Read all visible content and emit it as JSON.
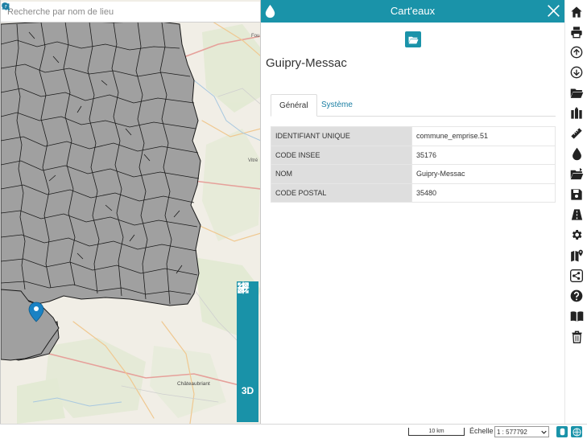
{
  "search": {
    "placeholder": "Recherche par nom de lieu",
    "value": ""
  },
  "map": {
    "place_labels": [
      {
        "id": "fou",
        "text": "Fou"
      },
      {
        "id": "vitr",
        "text": "Vitré"
      },
      {
        "id": "chateaubriant",
        "text": "Châteaubriant"
      }
    ],
    "controls": {
      "locate_icon": "crosshair-icon",
      "zoom_in": "+",
      "zoom_out": "−",
      "full_extent_icon": "extent-icon",
      "fullscreen_icon": "expand-icon",
      "mode_3d": "3D",
      "more": "•••"
    },
    "marker_icon": "map-marker-icon"
  },
  "panel": {
    "title": "Cart'eaux",
    "header_icon": "drop-icon",
    "close_icon": "close-icon",
    "open_button_icon": "folder-open-icon",
    "feature_title": "Guipry-Messac",
    "tabs": [
      {
        "label": "Général",
        "active": true
      },
      {
        "label": "Système",
        "active": false
      }
    ],
    "attributes": [
      {
        "key": "IDENTIFIANT UNIQUE",
        "value": "commune_emprise.51"
      },
      {
        "key": "CODE INSEE",
        "value": "35176"
      },
      {
        "key": "NOM",
        "value": "Guipry-Messac"
      },
      {
        "key": "CODE POSTAL",
        "value": "35480"
      }
    ]
  },
  "toolbar": {
    "items": [
      "home-icon",
      "print-icon",
      "upload-icon",
      "download-icon",
      "folder-open-icon",
      "map-layers-icon",
      "ruler-icon",
      "drop-icon",
      "folder-export-icon",
      "save-icon",
      "road-icon",
      "gear-icon",
      "map-pin-icon",
      "share-icon",
      "help-icon",
      "book-icon",
      "trash-icon"
    ]
  },
  "footer": {
    "scale_bar_label": "10 km",
    "scale_label": "Échelle :",
    "scale_value": "1 : 577792"
  },
  "colors": {
    "accent": "#1a93a9",
    "commune_fill": "#a0a0a0",
    "commune_stroke": "#1a1a1a",
    "basemap": "#f1eee6",
    "toolbar_icon": "#222222"
  }
}
